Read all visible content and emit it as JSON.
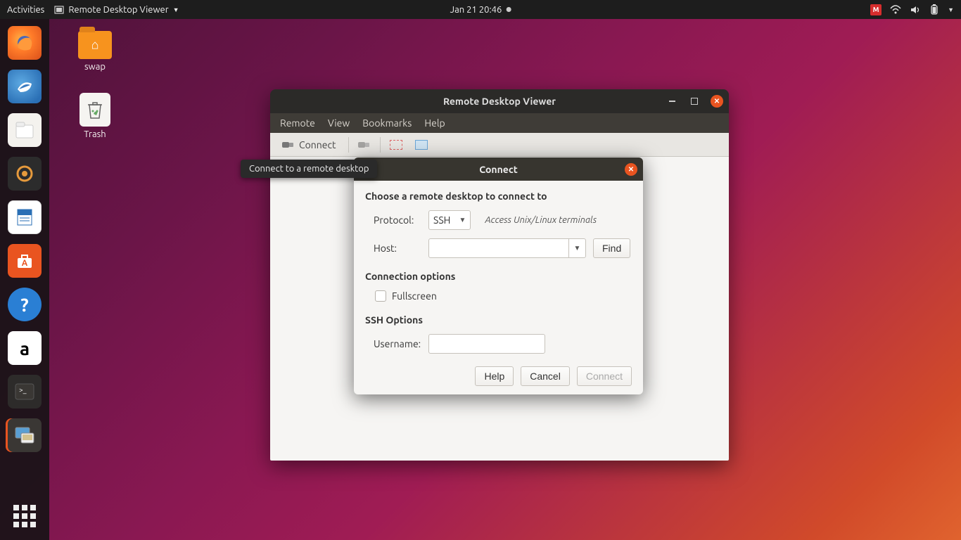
{
  "topbar": {
    "activities": "Activities",
    "app_name": "Remote Desktop Viewer",
    "datetime": "Jan 21  20:46"
  },
  "desktop": {
    "items": [
      {
        "label": "swap"
      },
      {
        "label": "Trash"
      }
    ]
  },
  "window": {
    "title": "Remote Desktop Viewer",
    "menu": {
      "items": [
        "Remote",
        "View",
        "Bookmarks",
        "Help"
      ]
    },
    "toolbar": {
      "connect": "Connect"
    }
  },
  "tooltip": "Connect to a remote desktop",
  "dialog": {
    "title": "Connect",
    "heading": "Choose a remote desktop to connect to",
    "protocol_label": "Protocol:",
    "protocol_value": "SSH",
    "protocol_hint": "Access Unix/Linux terminals",
    "host_label": "Host:",
    "host_value": "",
    "find_btn": "Find",
    "conn_options": "Connection options",
    "fullscreen": "Fullscreen",
    "ssh_options": "SSH Options",
    "username_label": "Username:",
    "username_value": "",
    "actions": {
      "help": "Help",
      "cancel": "Cancel",
      "connect": "Connect"
    }
  }
}
